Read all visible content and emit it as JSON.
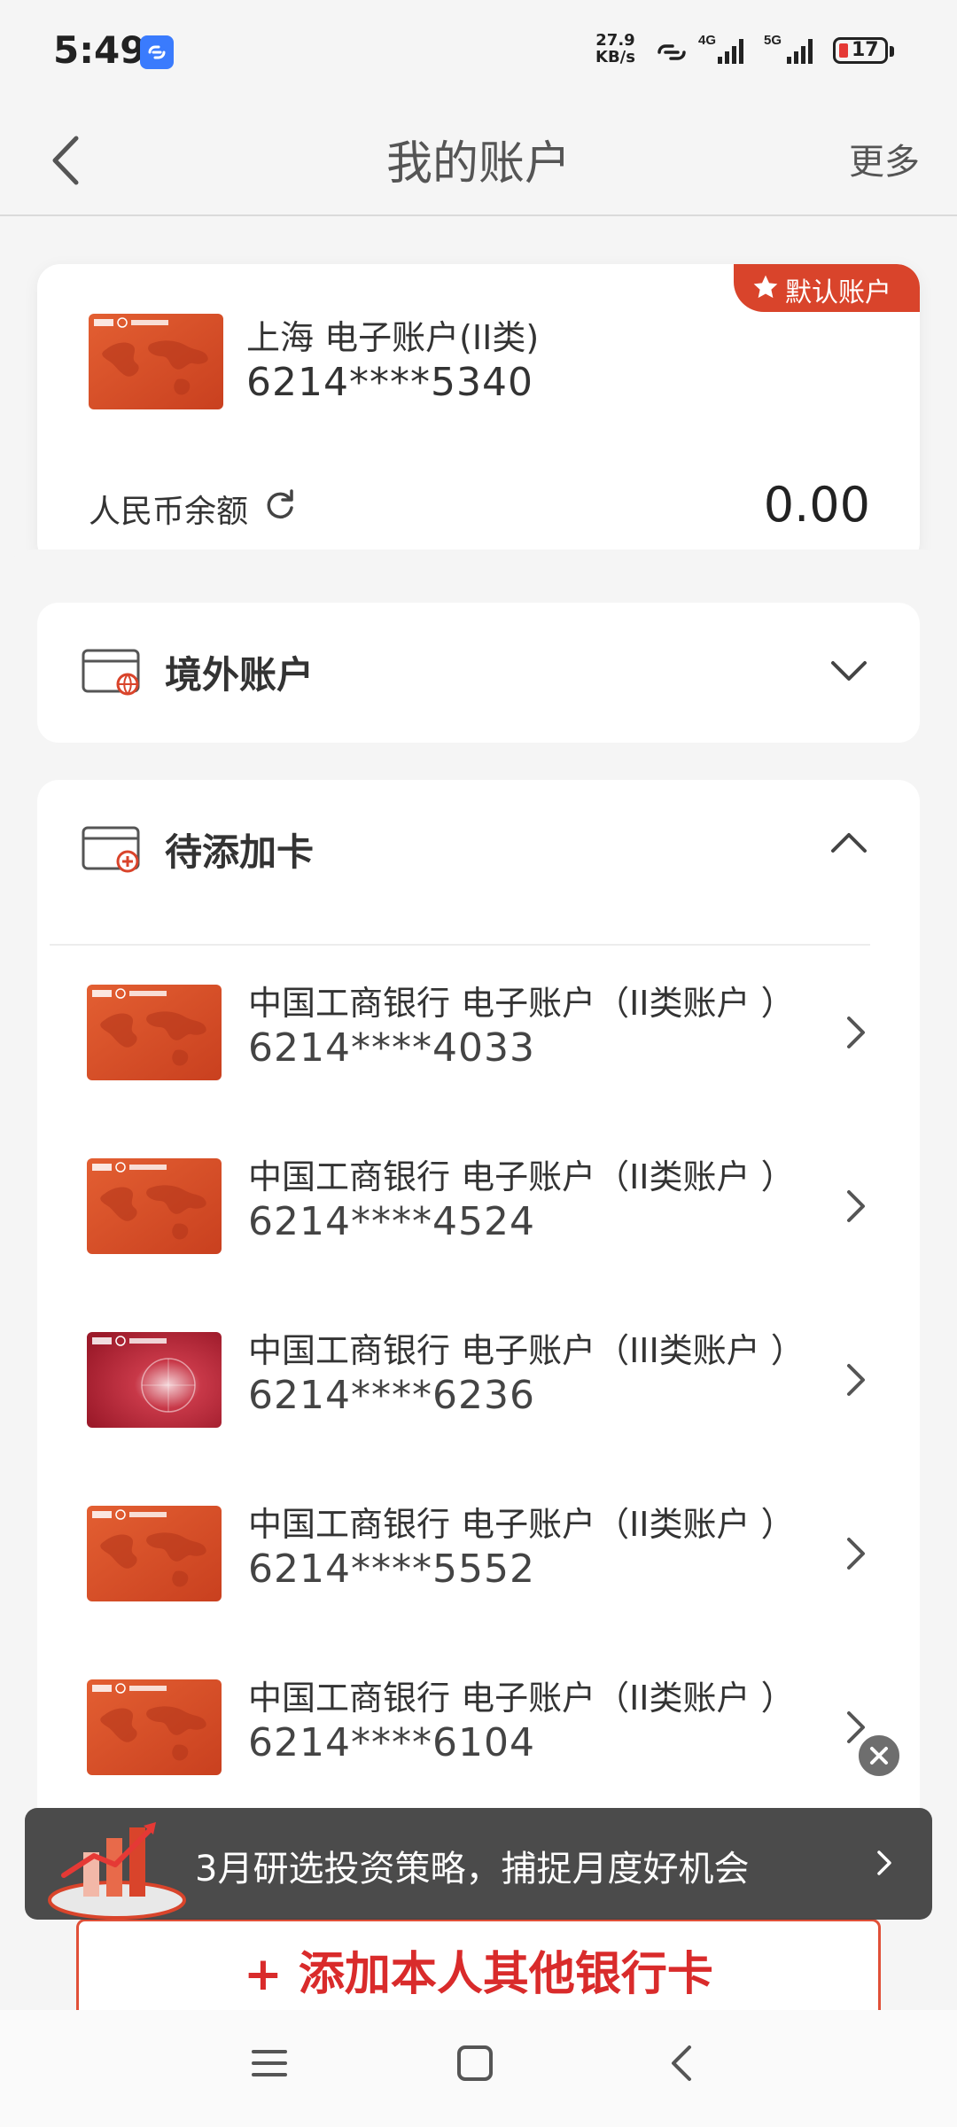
{
  "status_bar": {
    "time": "5:49",
    "net_speed_value": "27.9",
    "net_speed_unit": "KB/s",
    "net_4g": "4G",
    "net_5g": "5G",
    "battery_level": "17"
  },
  "header": {
    "title": "我的账户",
    "more": "更多"
  },
  "default_account": {
    "badge": "默认账户",
    "name": "上海 电子账户(II类)",
    "number": "6214****5340",
    "balance_label": "人民币余额",
    "balance_value": "0.00"
  },
  "sections": {
    "overseas": {
      "title": "境外账户"
    },
    "pending": {
      "title": "待添加卡"
    }
  },
  "cards": [
    {
      "name": "中国工商银行 电子账户（II类账户 ）",
      "number": "6214****4033",
      "style": "orange"
    },
    {
      "name": "中国工商银行 电子账户（II类账户 ）",
      "number": "6214****4524",
      "style": "orange"
    },
    {
      "name": "中国工商银行 电子账户（III类账户 ）",
      "number": "6214****6236",
      "style": "red"
    },
    {
      "name": "中国工商银行 电子账户（II类账户 ）",
      "number": "6214****5552",
      "style": "orange"
    },
    {
      "name": "中国工商银行 电子账户（II类账户 ）",
      "number": "6214****6104",
      "style": "orange"
    }
  ],
  "promo": {
    "text": "3月研选投资策略，捕捉月度好机会"
  },
  "add_card_button": "+ 添加本人其他银行卡",
  "colors": {
    "brand_red": "#d9442b",
    "card_orange": "#d9532a",
    "card_red": "#b8222e"
  }
}
